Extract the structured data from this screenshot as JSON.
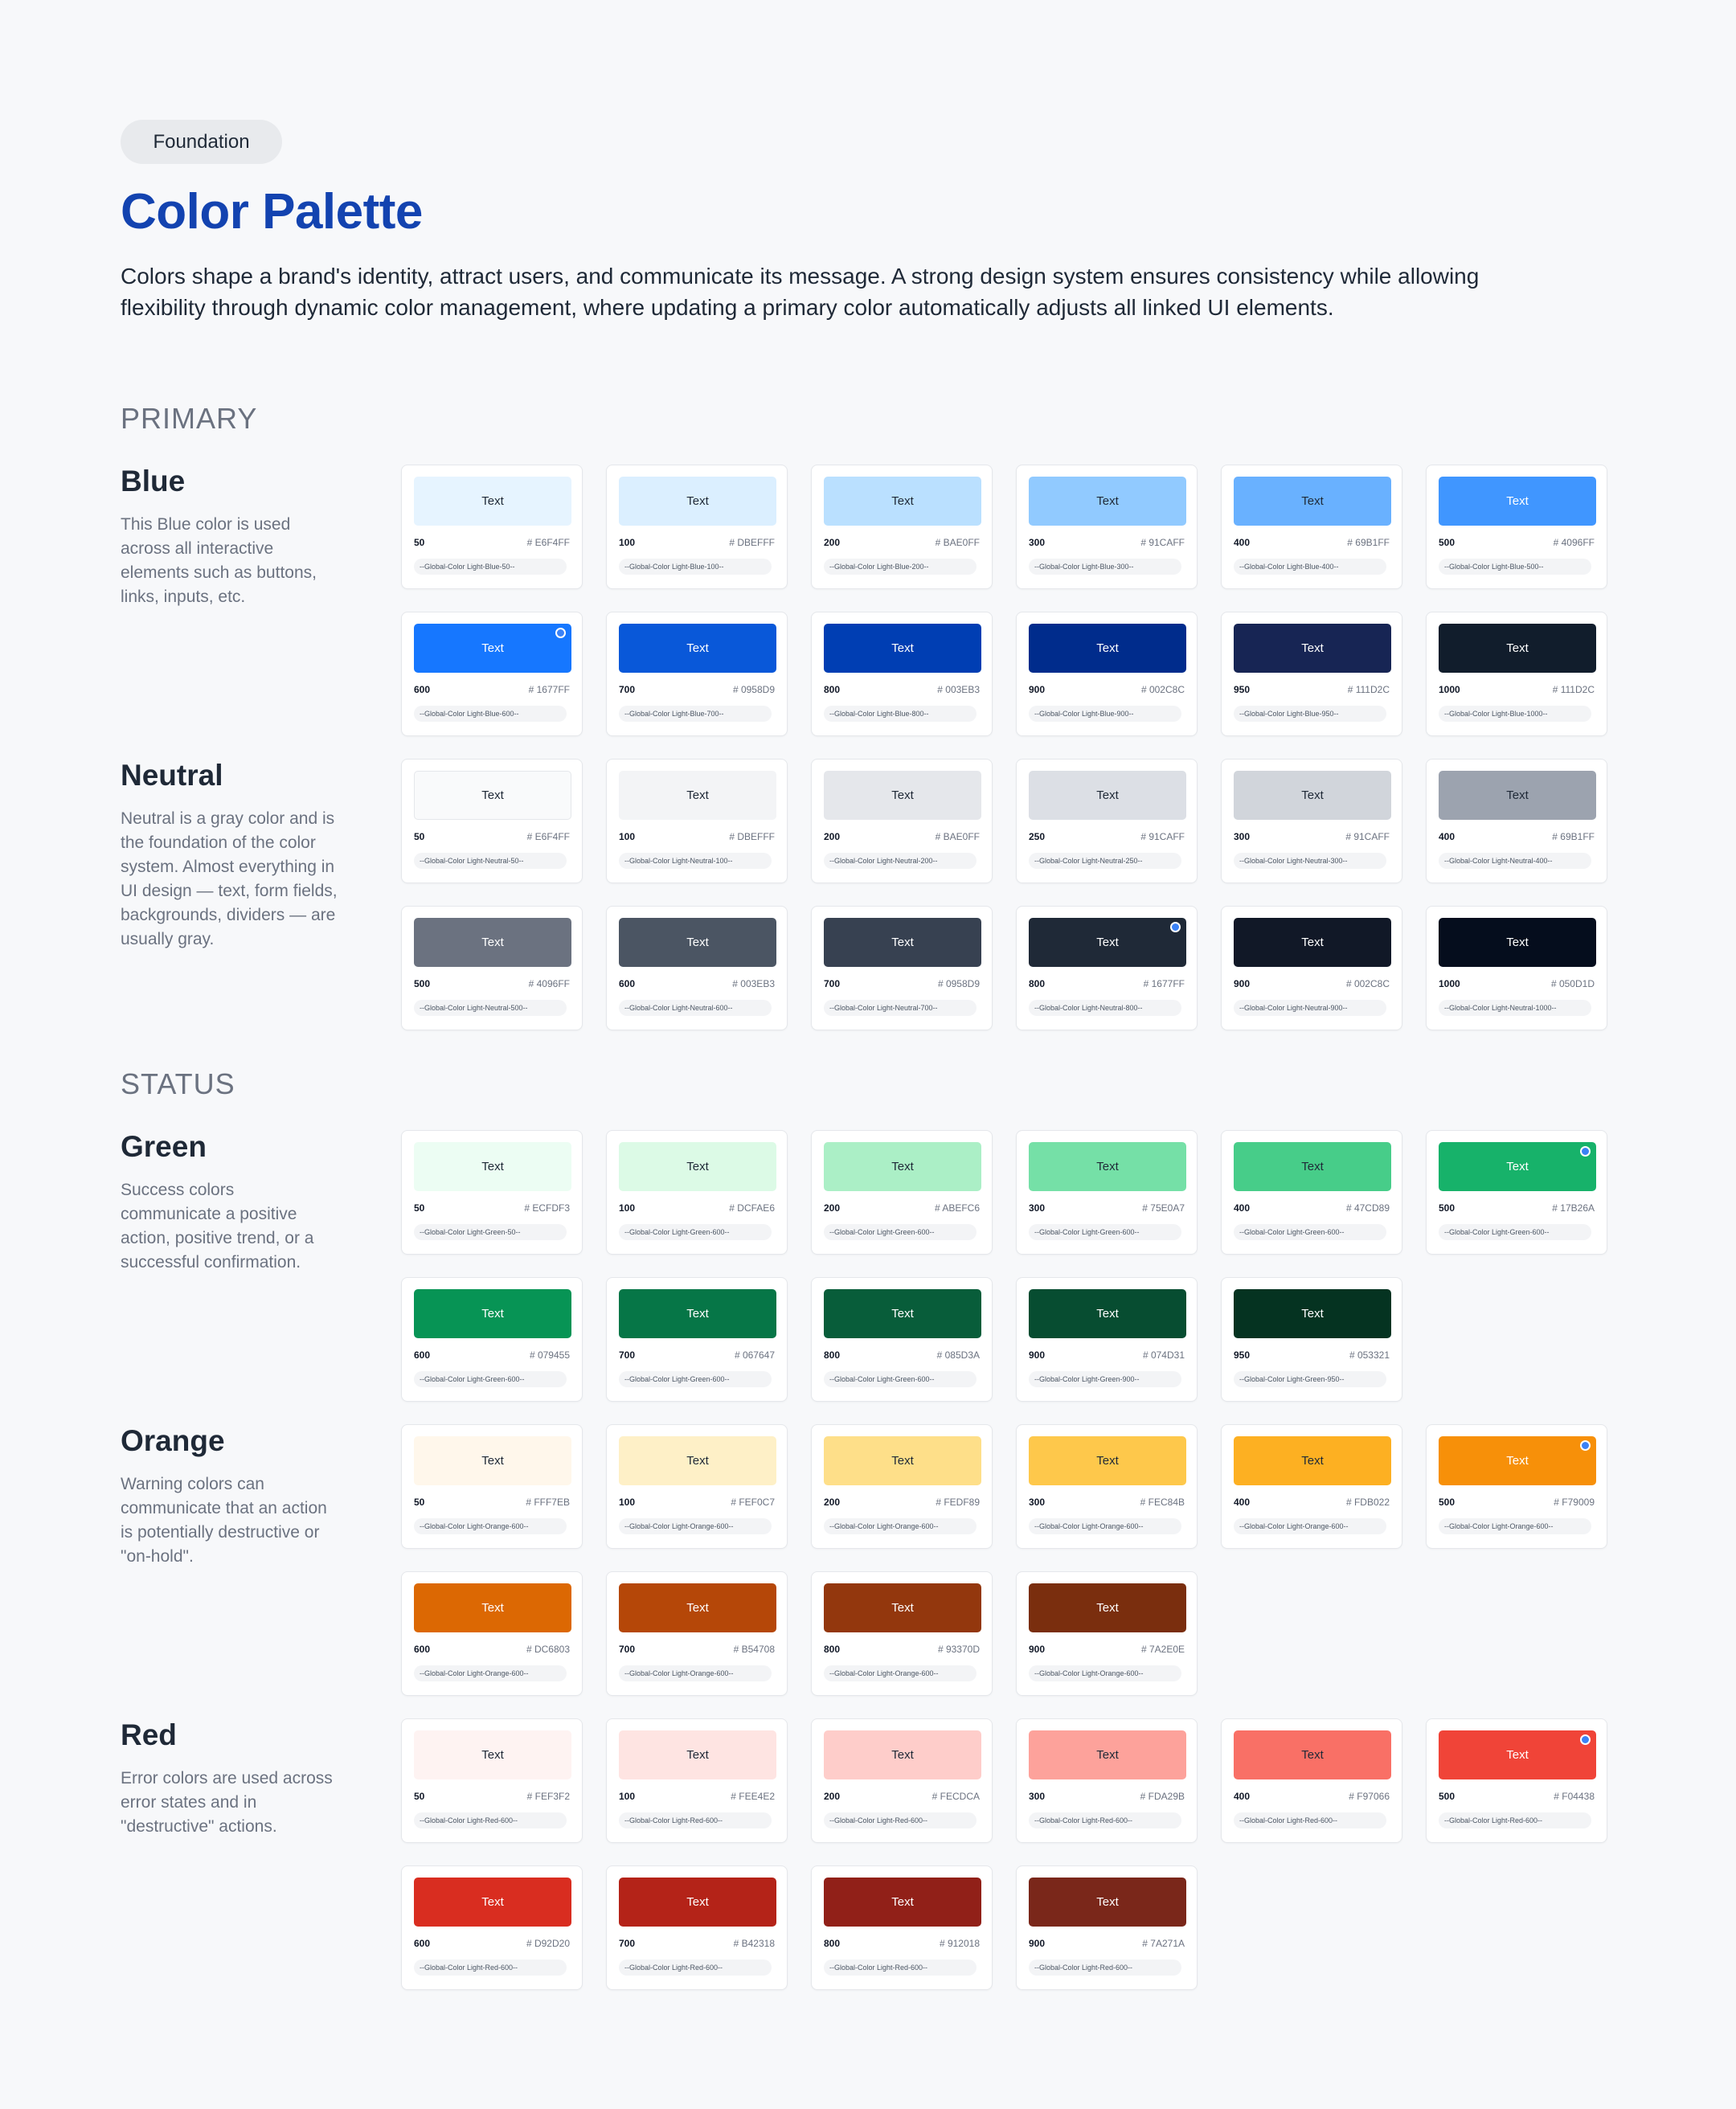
{
  "header": {
    "badge": "Foundation",
    "title": "Color Palette",
    "description": "Colors shape a brand's identity, attract users, and communicate its message. A strong design system ensures consistency while allowing flexibility through dynamic color management, where updating a primary color automatically adjusts all linked UI elements."
  },
  "sections": [
    {
      "title": "PRIMARY",
      "groups": [
        {
          "name": "Blue",
          "description": "This Blue color is used across all interactive elements such as buttons, links, inputs, etc.",
          "swatches": [
            {
              "label": "Text",
              "step": "50",
              "hex": "# E6F4FF",
              "token": "--Global-Color Light-Blue-50--",
              "color": "#E6F4FF",
              "text_color": "#1F2937"
            },
            {
              "label": "Text",
              "step": "100",
              "hex": "# DBEFFF",
              "token": "--Global-Color Light-Blue-100--",
              "color": "#DBEFFF",
              "text_color": "#1F2937"
            },
            {
              "label": "Text",
              "step": "200",
              "hex": "# BAE0FF",
              "token": "--Global-Color Light-Blue-200--",
              "color": "#BAE0FF",
              "text_color": "#1F2937"
            },
            {
              "label": "Text",
              "step": "300",
              "hex": "# 91CAFF",
              "token": "--Global-Color Light-Blue-300--",
              "color": "#91CAFF",
              "text_color": "#1F2937"
            },
            {
              "label": "Text",
              "step": "400",
              "hex": "# 69B1FF",
              "token": "--Global-Color Light-Blue-400--",
              "color": "#69B1FF",
              "text_color": "#1F2937"
            },
            {
              "label": "Text",
              "step": "500",
              "hex": "# 4096FF",
              "token": "--Global-Color Light-Blue-500--",
              "color": "#4096FF",
              "text_color": "#FFFFFF"
            },
            {
              "label": "Text",
              "step": "600",
              "hex": "# 1677FF",
              "token": "--Global-Color Light-Blue-600--",
              "color": "#1677FF",
              "text_color": "#FFFFFF",
              "selected": true
            },
            {
              "label": "Text",
              "step": "700",
              "hex": "# 0958D9",
              "token": "--Global-Color Light-Blue-700--",
              "color": "#0958D9",
              "text_color": "#FFFFFF"
            },
            {
              "label": "Text",
              "step": "800",
              "hex": "# 003EB3",
              "token": "--Global-Color Light-Blue-800--",
              "color": "#003EB3",
              "text_color": "#FFFFFF"
            },
            {
              "label": "Text",
              "step": "900",
              "hex": "# 002C8C",
              "token": "--Global-Color Light-Blue-900--",
              "color": "#002C8C",
              "text_color": "#FFFFFF"
            },
            {
              "label": "Text",
              "step": "950",
              "hex": "# 111D2C",
              "token": "--Global-Color Light-Blue-950--",
              "color": "#172554",
              "text_color": "#FFFFFF"
            },
            {
              "label": "Text",
              "step": "1000",
              "hex": "# 111D2C",
              "token": "--Global-Color Light-Blue-1000--",
              "color": "#111D2C",
              "text_color": "#FFFFFF"
            }
          ]
        },
        {
          "name": "Neutral",
          "description": "Neutral is a gray color and is the foundation of the color system. Almost everything in UI design — text, form fields, backgrounds, dividers — are usually gray.",
          "swatches": [
            {
              "label": "Text",
              "step": "50",
              "hex": "# E6F4FF",
              "token": "--Global-Color Light-Neutral-50--",
              "color": "#F9FAFB",
              "text_color": "#1F2937",
              "outlined": true
            },
            {
              "label": "Text",
              "step": "100",
              "hex": "# DBEFFF",
              "token": "--Global-Color Light-Neutral-100--",
              "color": "#F3F4F6",
              "text_color": "#1F2937"
            },
            {
              "label": "Text",
              "step": "200",
              "hex": "# BAE0FF",
              "token": "--Global-Color Light-Neutral-200--",
              "color": "#E5E7EB",
              "text_color": "#1F2937"
            },
            {
              "label": "Text",
              "step": "250",
              "hex": "# 91CAFF",
              "token": "--Global-Color Light-Neutral-250--",
              "color": "#DCDFE5",
              "text_color": "#1F2937"
            },
            {
              "label": "Text",
              "step": "300",
              "hex": "# 91CAFF",
              "token": "--Global-Color Light-Neutral-300--",
              "color": "#D1D5DB",
              "text_color": "#1F2937"
            },
            {
              "label": "Text",
              "step": "400",
              "hex": "# 69B1FF",
              "token": "--Global-Color Light-Neutral-400--",
              "color": "#9CA3AF",
              "text_color": "#1F2937"
            },
            {
              "label": "Text",
              "step": "500",
              "hex": "# 4096FF",
              "token": "--Global-Color Light-Neutral-500--",
              "color": "#6B7280",
              "text_color": "#FFFFFF"
            },
            {
              "label": "Text",
              "step": "600",
              "hex": "# 003EB3",
              "token": "--Global-Color Light-Neutral-600--",
              "color": "#4B5563",
              "text_color": "#FFFFFF"
            },
            {
              "label": "Text",
              "step": "700",
              "hex": "# 0958D9",
              "token": "--Global-Color Light-Neutral-700--",
              "color": "#374151",
              "text_color": "#FFFFFF"
            },
            {
              "label": "Text",
              "step": "800",
              "hex": "# 1677FF",
              "token": "--Global-Color Light-Neutral-800--",
              "color": "#1F2937",
              "text_color": "#FFFFFF",
              "selected": true
            },
            {
              "label": "Text",
              "step": "900",
              "hex": "# 002C8C",
              "token": "--Global-Color Light-Neutral-900--",
              "color": "#111827",
              "text_color": "#FFFFFF"
            },
            {
              "label": "Text",
              "step": "1000",
              "hex": "# 050D1D",
              "token": "--Global-Color Light-Neutral-1000--",
              "color": "#050D1D",
              "text_color": "#FFFFFF"
            }
          ]
        }
      ]
    },
    {
      "title": "STATUS",
      "groups": [
        {
          "name": "Green",
          "description": "Success colors communicate a positive action, positive trend, or a successful confirmation.",
          "swatches": [
            {
              "label": "Text",
              "step": "50",
              "hex": "# ECFDF3",
              "token": "--Global-Color Light-Green-50--",
              "color": "#ECFDF3",
              "text_color": "#1F2937"
            },
            {
              "label": "Text",
              "step": "100",
              "hex": "# DCFAE6",
              "token": "--Global-Color Light-Green-600--",
              "color": "#DCFAE6",
              "text_color": "#1F2937"
            },
            {
              "label": "Text",
              "step": "200",
              "hex": "# ABEFC6",
              "token": "--Global-Color Light-Green-600--",
              "color": "#ABEFC6",
              "text_color": "#1F2937"
            },
            {
              "label": "Text",
              "step": "300",
              "hex": "# 75E0A7",
              "token": "--Global-Color Light-Green-600--",
              "color": "#75E0A7",
              "text_color": "#1F2937"
            },
            {
              "label": "Text",
              "step": "400",
              "hex": "# 47CD89",
              "token": "--Global-Color Light-Green-600--",
              "color": "#47CD89",
              "text_color": "#1F2937"
            },
            {
              "label": "Text",
              "step": "500",
              "hex": "# 17B26A",
              "token": "--Global-Color Light-Green-600--",
              "color": "#17B26A",
              "text_color": "#FFFFFF",
              "selected": true
            },
            {
              "label": "Text",
              "step": "600",
              "hex": "# 079455",
              "token": "--Global-Color Light-Green-600--",
              "color": "#079455",
              "text_color": "#FFFFFF"
            },
            {
              "label": "Text",
              "step": "700",
              "hex": "# 067647",
              "token": "--Global-Color Light-Green-600--",
              "color": "#067647",
              "text_color": "#FFFFFF"
            },
            {
              "label": "Text",
              "step": "800",
              "hex": "# 085D3A",
              "token": "--Global-Color Light-Green-600--",
              "color": "#085D3A",
              "text_color": "#FFFFFF"
            },
            {
              "label": "Text",
              "step": "900",
              "hex": "# 074D31",
              "token": "--Global-Color Light-Green-900--",
              "color": "#074D31",
              "text_color": "#FFFFFF"
            },
            {
              "label": "Text",
              "step": "950",
              "hex": "# 053321",
              "token": "--Global-Color Light-Green-950--",
              "color": "#053321",
              "text_color": "#FFFFFF"
            }
          ]
        },
        {
          "name": "Orange",
          "description": "Warning colors can communicate that an action is potentially destructive or \"on-hold\".",
          "swatches": [
            {
              "label": "Text",
              "step": "50",
              "hex": "# FFF7EB",
              "token": "--Global-Color Light-Orange-600--",
              "color": "#FFF7EB",
              "text_color": "#1F2937"
            },
            {
              "label": "Text",
              "step": "100",
              "hex": "# FEF0C7",
              "token": "--Global-Color Light-Orange-600--",
              "color": "#FEF0C7",
              "text_color": "#1F2937"
            },
            {
              "label": "Text",
              "step": "200",
              "hex": "# FEDF89",
              "token": "--Global-Color Light-Orange-600--",
              "color": "#FEDF89",
              "text_color": "#1F2937"
            },
            {
              "label": "Text",
              "step": "300",
              "hex": "# FEC84B",
              "token": "--Global-Color Light-Orange-600--",
              "color": "#FEC84B",
              "text_color": "#1F2937"
            },
            {
              "label": "Text",
              "step": "400",
              "hex": "# FDB022",
              "token": "--Global-Color Light-Orange-600--",
              "color": "#FDB022",
              "text_color": "#1F2937"
            },
            {
              "label": "Text",
              "step": "500",
              "hex": "# F79009",
              "token": "--Global-Color Light-Orange-600--",
              "color": "#F79009",
              "text_color": "#FFFFFF",
              "selected": true
            },
            {
              "label": "Text",
              "step": "600",
              "hex": "# DC6803",
              "token": "--Global-Color Light-Orange-600--",
              "color": "#DC6803",
              "text_color": "#FFFFFF"
            },
            {
              "label": "Text",
              "step": "700",
              "hex": "# B54708",
              "token": "--Global-Color Light-Orange-600--",
              "color": "#B54708",
              "text_color": "#FFFFFF"
            },
            {
              "label": "Text",
              "step": "800",
              "hex": "# 93370D",
              "token": "--Global-Color Light-Orange-600--",
              "color": "#93370D",
              "text_color": "#FFFFFF"
            },
            {
              "label": "Text",
              "step": "900",
              "hex": "# 7A2E0E",
              "token": "--Global-Color Light-Orange-600--",
              "color": "#7A2E0E",
              "text_color": "#FFFFFF"
            }
          ]
        },
        {
          "name": "Red",
          "description": "Error colors are used across error states and in \"destructive\" actions.",
          "swatches": [
            {
              "label": "Text",
              "step": "50",
              "hex": "# FEF3F2",
              "token": "--Global-Color Light-Red-600--",
              "color": "#FEF3F2",
              "text_color": "#1F2937"
            },
            {
              "label": "Text",
              "step": "100",
              "hex": "# FEE4E2",
              "token": "--Global-Color Light-Red-600--",
              "color": "#FEE4E2",
              "text_color": "#1F2937"
            },
            {
              "label": "Text",
              "step": "200",
              "hex": "# FECDCA",
              "token": "--Global-Color Light-Red-600--",
              "color": "#FECDCA",
              "text_color": "#1F2937"
            },
            {
              "label": "Text",
              "step": "300",
              "hex": "# FDA29B",
              "token": "--Global-Color Light-Red-600--",
              "color": "#FDA29B",
              "text_color": "#1F2937"
            },
            {
              "label": "Text",
              "step": "400",
              "hex": "# F97066",
              "token": "--Global-Color Light-Red-600--",
              "color": "#F97066",
              "text_color": "#1F2937"
            },
            {
              "label": "Text",
              "step": "500",
              "hex": "# F04438",
              "token": "--Global-Color Light-Red-600--",
              "color": "#F04438",
              "text_color": "#FFFFFF",
              "selected": true
            },
            {
              "label": "Text",
              "step": "600",
              "hex": "# D92D20",
              "token": "--Global-Color Light-Red-600--",
              "color": "#D92D20",
              "text_color": "#FFFFFF"
            },
            {
              "label": "Text",
              "step": "700",
              "hex": "# B42318",
              "token": "--Global-Color Light-Red-600--",
              "color": "#B42318",
              "text_color": "#FFFFFF"
            },
            {
              "label": "Text",
              "step": "800",
              "hex": "# 912018",
              "token": "--Global-Color Light-Red-600--",
              "color": "#912018",
              "text_color": "#FFFFFF"
            },
            {
              "label": "Text",
              "step": "900",
              "hex": "# 7A271A",
              "token": "--Global-Color Light-Red-600--",
              "color": "#7A271A",
              "text_color": "#FFFFFF"
            }
          ]
        }
      ]
    }
  ]
}
